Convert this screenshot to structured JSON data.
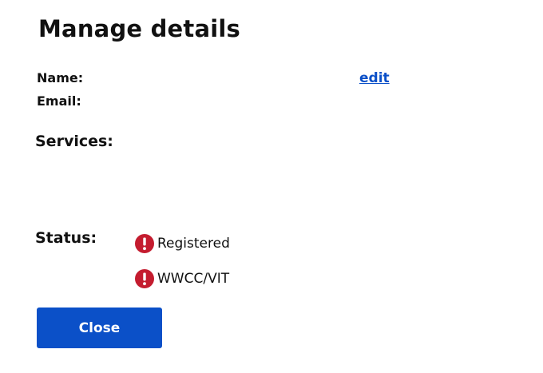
{
  "header": {
    "title": "Manage details"
  },
  "details": {
    "name_label": "Name:",
    "email_label": "Email:",
    "edit_label": "edit",
    "services_label": "Services:"
  },
  "status": {
    "label": "Status:",
    "items": [
      {
        "label": "Registered",
        "icon": "alert-circle-icon",
        "color": "#c41c2f"
      },
      {
        "label": "WWCC/VIT",
        "icon": "alert-circle-icon",
        "color": "#c41c2f"
      }
    ]
  },
  "actions": {
    "close_label": "Close",
    "primary_color": "#0b50c8"
  }
}
